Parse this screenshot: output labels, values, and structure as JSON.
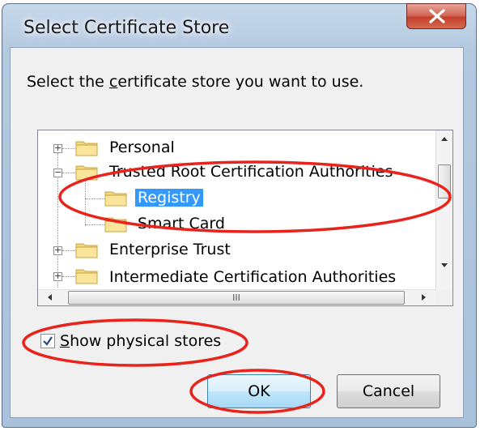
{
  "window": {
    "title": "Select Certificate Store"
  },
  "prompt": {
    "before": "Select the ",
    "underlined": "c",
    "after": "ertificate store you want to use."
  },
  "tree": {
    "items": [
      {
        "label": "Personal",
        "expander": "+",
        "level": 0
      },
      {
        "label": "Trusted Root Certification Authorities",
        "expander": "−",
        "level": 0
      },
      {
        "label": "Registry",
        "level": 1,
        "selected": true
      },
      {
        "label": "Smart Card",
        "level": 1
      },
      {
        "label": "Enterprise Trust",
        "expander": "+",
        "level": 0
      },
      {
        "label": "Intermediate Certification Authorities",
        "expander": "+",
        "level": 0
      }
    ],
    "hscroll_grip": "III"
  },
  "checkbox": {
    "underlined": "S",
    "rest": "how physical stores",
    "checked": true
  },
  "buttons": {
    "ok": "OK",
    "cancel": "Cancel"
  },
  "colors": {
    "annotation": "#e8231c",
    "selection": "#3399ff"
  }
}
